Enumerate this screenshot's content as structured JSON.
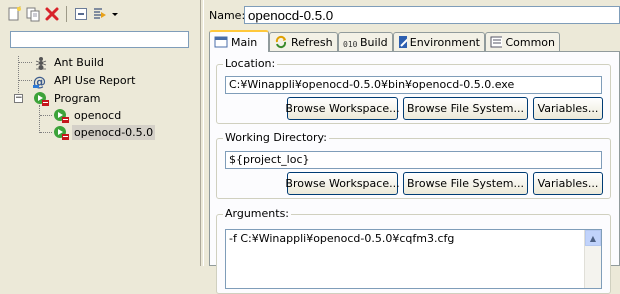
{
  "toolbar": {
    "icons": [
      "new-config-icon",
      "duplicate-icon",
      "delete-icon",
      "collapse-all-icon",
      "filter-icon",
      "dropdown-arrow-icon"
    ]
  },
  "filter": {
    "value": ""
  },
  "tree": {
    "items": [
      {
        "label": "Ant Build",
        "icon": "ant-icon"
      },
      {
        "label": "API Use Report",
        "icon": "api-report-icon"
      },
      {
        "label": "Program",
        "icon": "program-icon"
      },
      {
        "label": "openocd",
        "icon": "program-config-icon"
      },
      {
        "label": "openocd-0.5.0",
        "icon": "program-config-icon",
        "selected": true
      }
    ]
  },
  "name": {
    "label": "Name:",
    "value": "openocd-0.5.0"
  },
  "tabs": [
    {
      "label": "Main",
      "icon": "main-tab-icon",
      "active": true
    },
    {
      "label": "Refresh",
      "icon": "refresh-icon"
    },
    {
      "label": "Build",
      "icon": "build-icon"
    },
    {
      "label": "Environment",
      "icon": "environment-icon"
    },
    {
      "label": "Common",
      "icon": "common-icon"
    }
  ],
  "location": {
    "title": "Location:",
    "value": "C:¥Winappli¥openocd-0.5.0¥bin¥openocd-0.5.0.exe",
    "buttons": [
      "Browse Workspace...",
      "Browse File System...",
      "Variables..."
    ]
  },
  "working_directory": {
    "title": "Working Directory:",
    "value": "${project_loc}",
    "buttons": [
      "Browse Workspace...",
      "Browse File System...",
      "Variables..."
    ]
  },
  "arguments": {
    "title": "Arguments:",
    "value": "-f C:¥Winappli¥openocd-0.5.0¥cqfm3.cfg"
  },
  "colors": {
    "accent_tab": "#ffc83c",
    "panel_bg": "#fcfcfe",
    "window_bg": "#ece9d8"
  }
}
